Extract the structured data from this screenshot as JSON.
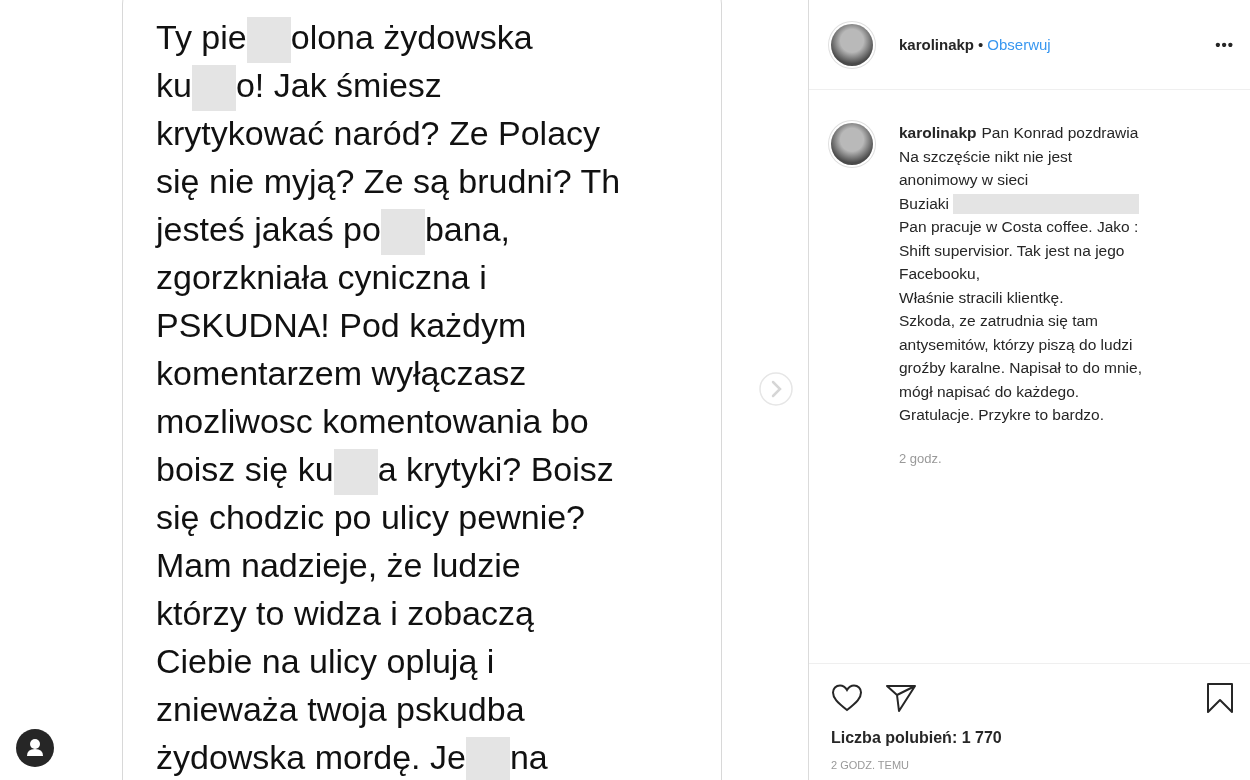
{
  "message": {
    "lines": [
      [
        {
          "kind": "text",
          "text": "Ty pie"
        },
        {
          "kind": "censor"
        },
        {
          "kind": "text",
          "text": "olona żydowska"
        }
      ],
      [
        {
          "kind": "text",
          "text": "ku"
        },
        {
          "kind": "censor"
        },
        {
          "kind": "text",
          "text": "o! Jak śmiesz"
        }
      ],
      [
        {
          "kind": "text",
          "text": "krytykować naród? Ze Polacy"
        }
      ],
      [
        {
          "kind": "text",
          "text": "się nie myją? Ze są brudni? Th"
        }
      ],
      [
        {
          "kind": "text",
          "text": "jesteś jakaś po"
        },
        {
          "kind": "censor"
        },
        {
          "kind": "text",
          "text": "bana,"
        }
      ],
      [
        {
          "kind": "text",
          "text": "zgorzkniała cyniczna i"
        }
      ],
      [
        {
          "kind": "text",
          "text": "PSKUDNA! Pod każdym"
        }
      ],
      [
        {
          "kind": "text",
          "text": "komentarzem wyłączasz"
        }
      ],
      [
        {
          "kind": "text",
          "text": "mozliwosc komentowania bo"
        }
      ],
      [
        {
          "kind": "text",
          "text": "boisz się ku"
        },
        {
          "kind": "censor"
        },
        {
          "kind": "text",
          "text": "a krytyki? Boisz"
        }
      ],
      [
        {
          "kind": "text",
          "text": "się chodzic po ulicy pewnie?"
        }
      ],
      [
        {
          "kind": "text",
          "text": "Mam nadzieje, że ludzie"
        }
      ],
      [
        {
          "kind": "text",
          "text": "którzy to widza i zobaczą"
        }
      ],
      [
        {
          "kind": "text",
          "text": "Ciebie na ulicy oplują i"
        }
      ],
      [
        {
          "kind": "text",
          "text": "znieważa twoja pskudba"
        }
      ],
      [
        {
          "kind": "text",
          "text": "żydowska mordę. Je"
        },
        {
          "kind": "censor"
        },
        {
          "kind": "text",
          "text": "na"
        }
      ]
    ]
  },
  "header": {
    "username": "karolinakp",
    "separator": "•",
    "follow": "Obserwuj",
    "more": "•••"
  },
  "comment": {
    "username": "karolinakp",
    "lines": [
      [
        {
          "kind": "text",
          "text": "Pan Konrad pozdrawia"
        }
      ],
      [
        {
          "kind": "text",
          "text": "Na szczęście nikt nie jest"
        }
      ],
      [
        {
          "kind": "text",
          "text": "anonimowy w sieci"
        }
      ],
      [
        {
          "kind": "text",
          "text": "Buziaki"
        },
        {
          "kind": "censor"
        }
      ],
      [
        {
          "kind": "text",
          "text": "Pan pracuje w Costa coffee. Jako :"
        }
      ],
      [
        {
          "kind": "text",
          "text": "Shift supervisior. Tak jest na jego"
        }
      ],
      [
        {
          "kind": "text",
          "text": "Facebooku,"
        }
      ],
      [
        {
          "kind": "text",
          "text": "Właśnie stracili klientkę."
        }
      ],
      [
        {
          "kind": "text",
          "text": "Szkoda, ze zatrudnia się tam"
        }
      ],
      [
        {
          "kind": "text",
          "text": "antysemitów, którzy piszą do ludzi"
        }
      ],
      [
        {
          "kind": "text",
          "text": "groźby karalne. Napisał to do mnie,"
        }
      ],
      [
        {
          "kind": "text",
          "text": "mógł napisać do każdego."
        }
      ],
      [
        {
          "kind": "text",
          "text": "Gratulacje. Przykre to bardzo."
        }
      ]
    ],
    "time": "2 godz."
  },
  "footer": {
    "likes": "Liczba polubień: 1 770",
    "posted": "2 GODZ. TEMU"
  }
}
